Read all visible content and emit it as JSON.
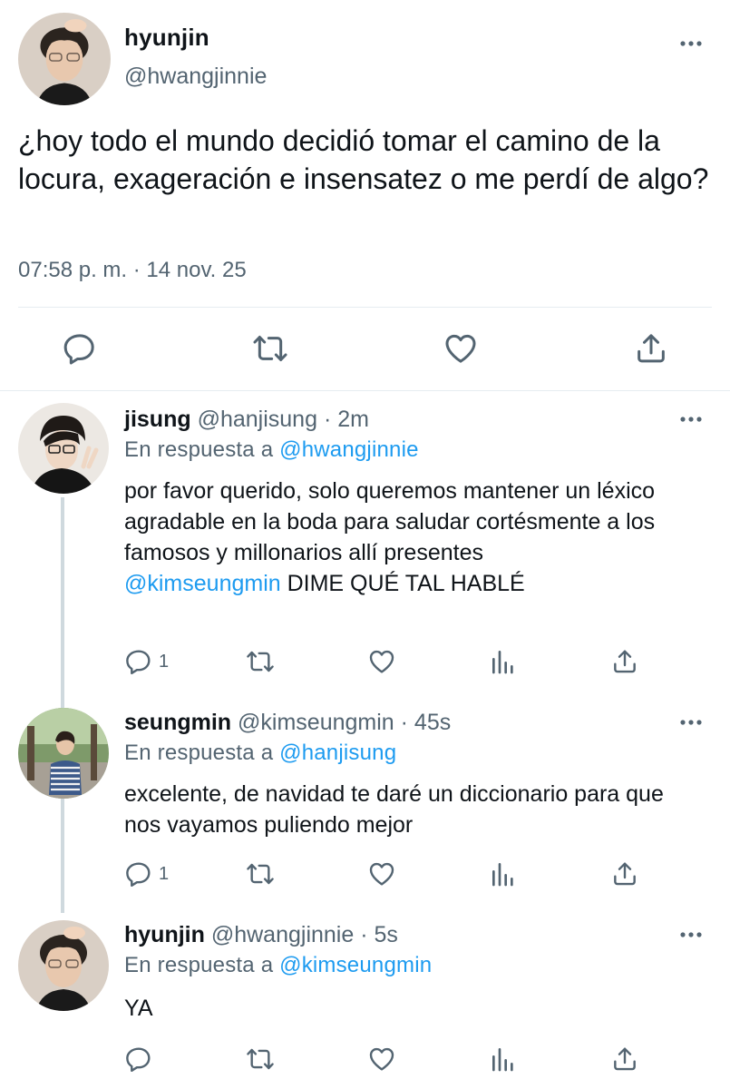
{
  "main_tweet": {
    "display_name": "hyunjin",
    "handle": "@hwangjinnie",
    "text": "¿hoy todo el mundo decidió tomar el camino de la locura, exageración e insensatez o me perdí de algo?",
    "timestamp": "07:58 p. m. · 14 nov. 25",
    "actions": [
      "reply-icon",
      "retweet-icon",
      "like-icon",
      "share-icon"
    ]
  },
  "replies": [
    {
      "display_name": "jisung",
      "handle": "@hanjisung",
      "time": "· 2m",
      "reply_prefix": "En respuesta a",
      "reply_to": "@hwangjinnie",
      "text": "por favor querido, solo queremos mantener un léxico agradable en la boda para saludar cortésmente a los famosos y millonarios allí presentes",
      "mention": "@kimseungmin",
      "mention_text": " DIME QUÉ TAL HABLÉ",
      "reply_count": "1"
    },
    {
      "display_name": "seungmin",
      "handle": "@kimseungmin",
      "time": "· 45s",
      "reply_prefix": "En respuesta a",
      "reply_to": "@hanjisung",
      "text": "excelente, de navidad te daré un diccionario para que nos vayamos puliendo mejor",
      "reply_count": "1"
    },
    {
      "display_name": "hyunjin",
      "handle": "@hwangjinnie",
      "time": "· 5s",
      "reply_prefix": "En respuesta a",
      "reply_to": "@kimseungmin",
      "text": "YA",
      "reply_count": ""
    }
  ],
  "colors": {
    "link": "#1d9bf0",
    "secondary_text": "#536471",
    "divider": "#e6ecf0",
    "thread_line": "#cfd9de"
  }
}
